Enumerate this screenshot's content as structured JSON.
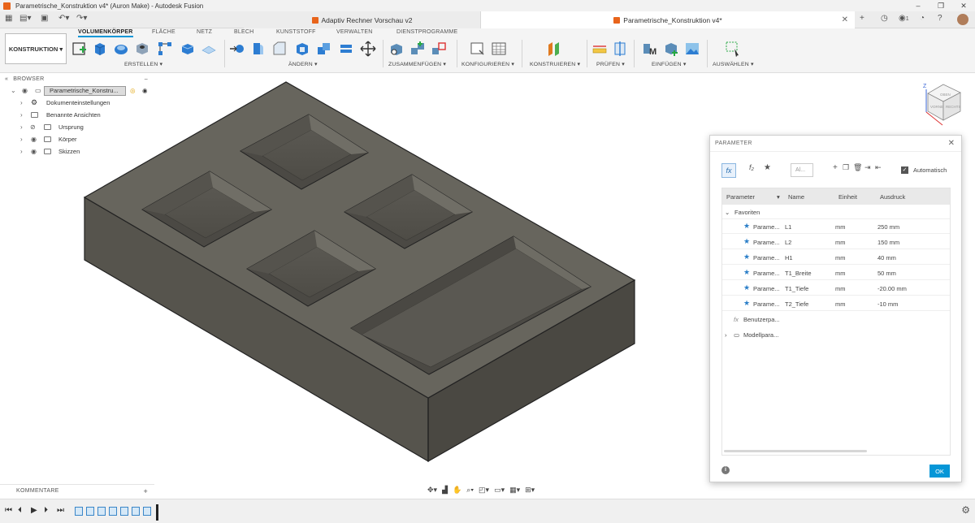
{
  "window": {
    "title": "Parametrische_Konstruktion v4* (Auron Make) - Autodesk Fusion"
  },
  "tabs": [
    {
      "label": "Adaptiv Rechner Vorschau v2",
      "active": false
    },
    {
      "label": "Parametrische_Konstruktion v4*",
      "active": true
    }
  ],
  "tabbar_right": {
    "job_count": "1"
  },
  "toolbar": {
    "workspace": "KONSTRUKTION",
    "ribbon_tabs": [
      "VOLUMENKÖRPER",
      "FLÄCHE",
      "NETZ",
      "BLECH",
      "KUNSTSTOFF",
      "VERWALTEN",
      "DIENSTPROGRAMME"
    ],
    "groups": [
      "ERSTELLEN",
      "ÄNDERN",
      "ZUSAMMENFÜGEN",
      "KONFIGURIEREN",
      "KONSTRUIEREN",
      "PRÜFEN",
      "EINFÜGEN",
      "AUSWÄHLEN"
    ]
  },
  "browser": {
    "header": "BROWSER",
    "root": "Parametrische_Konstru...",
    "items": [
      "Dokumenteinstellungen",
      "Benannte Ansichten",
      "Ursprung",
      "Körper",
      "Skizzen"
    ]
  },
  "comments": {
    "label": "KOMMENTARE"
  },
  "viewcube": {
    "axis_z": "Z",
    "faces": [
      "OBEN",
      "VORNE",
      "RECHTS"
    ]
  },
  "parameter_dialog": {
    "title": "PARAMETER",
    "search_placeholder": "Al...",
    "auto_label": "Automatisch",
    "columns": [
      "Parameter",
      "Name",
      "Einheit",
      "Ausdruck"
    ],
    "favorites_label": "Favoriten",
    "rows": [
      {
        "param": "Parame...",
        "name": "L1",
        "unit": "mm",
        "expr": "250 mm"
      },
      {
        "param": "Parame...",
        "name": "L2",
        "unit": "mm",
        "expr": "150 mm"
      },
      {
        "param": "Parame...",
        "name": "H1",
        "unit": "mm",
        "expr": "40 mm"
      },
      {
        "param": "Parame...",
        "name": "T1_Breite",
        "unit": "mm",
        "expr": "50 mm"
      },
      {
        "param": "Parame...",
        "name": "T1_Tiefe",
        "unit": "mm",
        "expr": "-20.00 mm"
      },
      {
        "param": "Parame...",
        "name": "T2_Tiefe",
        "unit": "mm",
        "expr": "-10 mm"
      }
    ],
    "user_params": "Benutzerpa...",
    "model_params": "Modellpara...",
    "ok_label": "OK"
  },
  "colors": {
    "accent": "#0696d7",
    "model_top": "#67655d",
    "model_front": "#56544d",
    "model_side": "#4a4842"
  }
}
